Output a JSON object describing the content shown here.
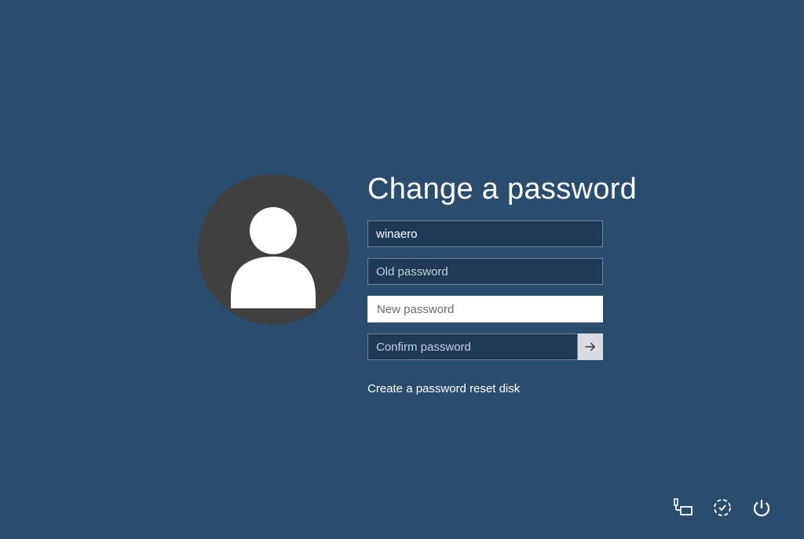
{
  "title": "Change a password",
  "username": "winaero",
  "placeholders": {
    "old_password": "Old password",
    "new_password": "New password",
    "confirm_password": "Confirm password"
  },
  "link": "Create a password reset disk",
  "icons": {
    "network": "network-icon",
    "ease_of_access": "ease-of-access-icon",
    "power": "power-icon",
    "submit": "arrow-right-icon",
    "avatar": "user-avatar-icon"
  }
}
